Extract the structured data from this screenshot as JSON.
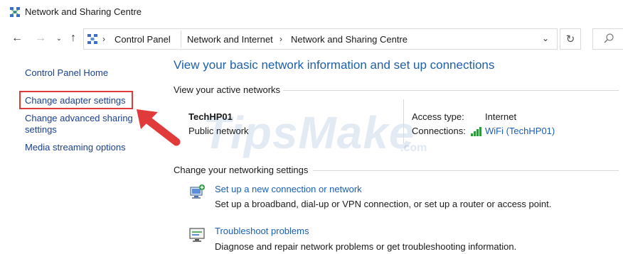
{
  "window": {
    "title": "Network and Sharing Centre",
    "icon": "network-sharing-icon"
  },
  "nav": {
    "back": "back-arrow-icon",
    "forward": "forward-arrow-icon",
    "recent": "chevron-down-icon",
    "up": "up-arrow-icon"
  },
  "address": {
    "crumbs": [
      "Control Panel",
      "Network and Internet",
      "Network and Sharing Centre"
    ],
    "dropdown": "chevron-down-icon",
    "refresh": "refresh-icon",
    "search": "search-icon"
  },
  "sidebar": {
    "items": [
      {
        "label": "Control Panel Home"
      },
      {
        "label": "Change adapter settings"
      },
      {
        "label": "Change advanced sharing",
        "label2": "settings"
      },
      {
        "label": "Media streaming options"
      }
    ],
    "highlight_color": "#e03a3a"
  },
  "main": {
    "title": "View your basic network information and set up connections",
    "active_header": "View your active networks",
    "network": {
      "name": "TechHP01",
      "type": "Public network",
      "access_label": "Access type:",
      "access_value": "Internet",
      "connections_label": "Connections:",
      "connection_link": "WiFi (TechHP01)"
    },
    "settings_header": "Change your networking settings",
    "tasks": [
      {
        "link": "Set up a new connection or network",
        "desc": "Set up a broadband, dial-up or VPN connection, or set up a router or access point.",
        "icon": "new-connection-icon"
      },
      {
        "link": "Troubleshoot problems",
        "desc": "Diagnose and repair network problems or get troubleshooting information.",
        "icon": "troubleshoot-icon"
      }
    ]
  },
  "watermark": {
    "text": "TipsMake",
    "suffix": ".com"
  },
  "colors": {
    "link": "#1a5fb4",
    "title": "#1f5fa8",
    "accent_red": "#e03a3a"
  }
}
